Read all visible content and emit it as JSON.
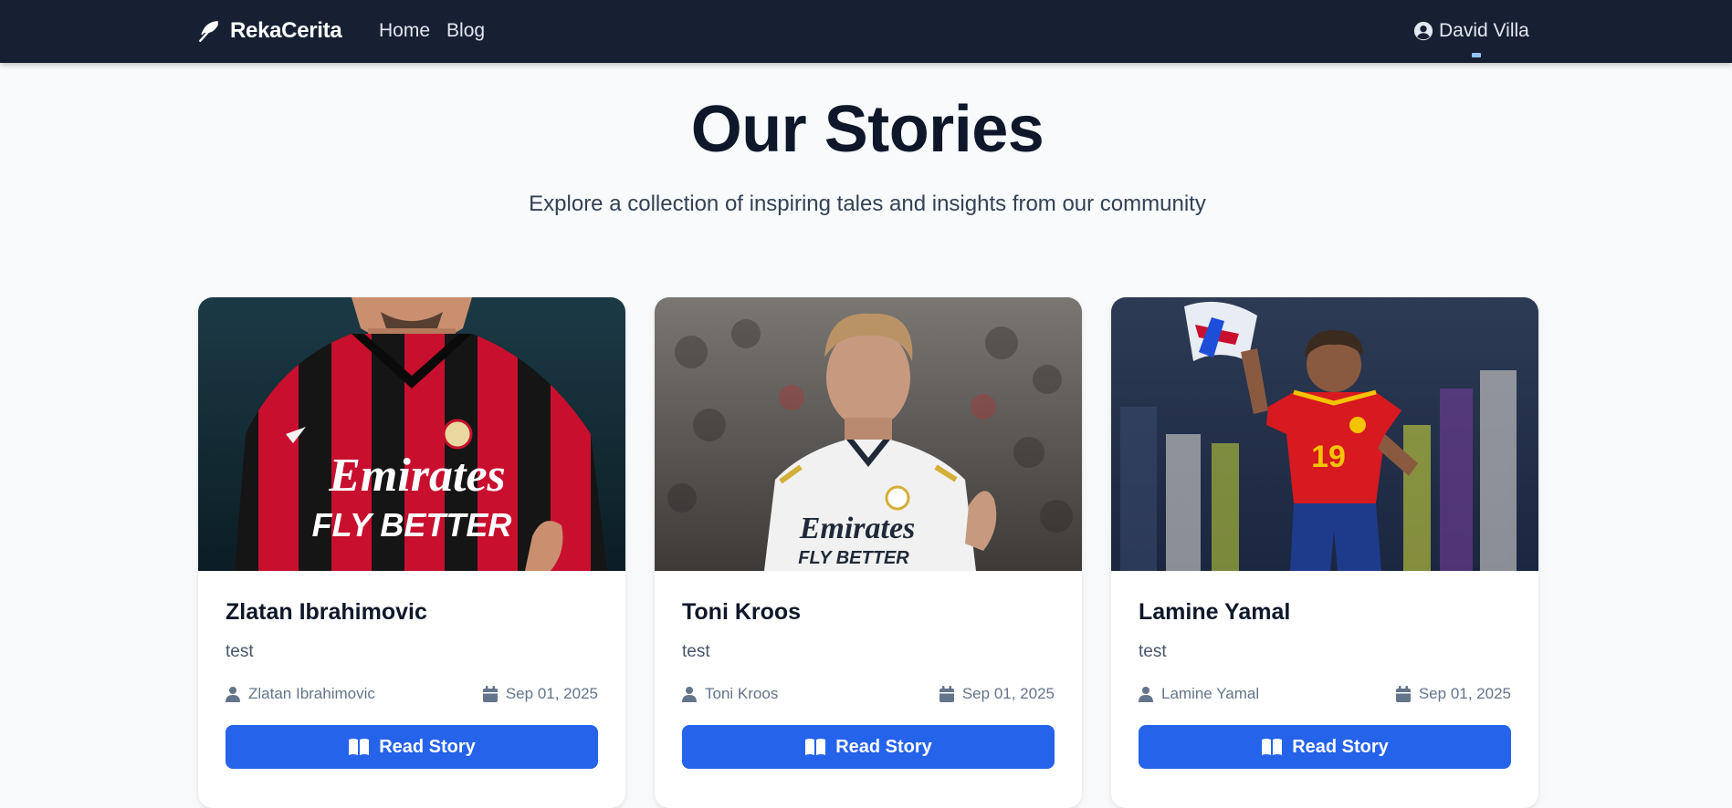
{
  "navbar": {
    "brand": "RekaCerita",
    "links": [
      "Home",
      "Blog"
    ],
    "user_name": "David Villa"
  },
  "hero": {
    "title": "Our Stories",
    "subtitle": "Explore a collection of inspiring tales and insights from our community"
  },
  "stories": [
    {
      "title": "Zlatan Ibrahimovic",
      "excerpt": "test",
      "author": "Zlatan Ibrahimovic",
      "date": "Sep 01, 2025",
      "button_label": "Read Story",
      "image_lettering": [
        "Emirates",
        "FLY BETTER"
      ]
    },
    {
      "title": "Toni Kroos",
      "excerpt": "test",
      "author": "Toni Kroos",
      "date": "Sep 01, 2025",
      "button_label": "Read Story",
      "image_lettering": [
        "Emirates",
        "FLY BETTER"
      ]
    },
    {
      "title": "Lamine Yamal",
      "excerpt": "test",
      "author": "Lamine Yamal",
      "date": "Sep 01, 2025",
      "button_label": "Read Story",
      "image_lettering": [
        "19"
      ]
    }
  ],
  "icons": {
    "brand": "feather-icon",
    "user": "user-circle-icon",
    "author": "user-icon",
    "date": "calendar-icon",
    "read": "book-open-icon"
  },
  "colors": {
    "navbar_bg": "#172033",
    "page_bg": "#f8fafc",
    "accent": "#2563eb",
    "title_text": "#0f172a",
    "muted_text": "#64748b"
  }
}
